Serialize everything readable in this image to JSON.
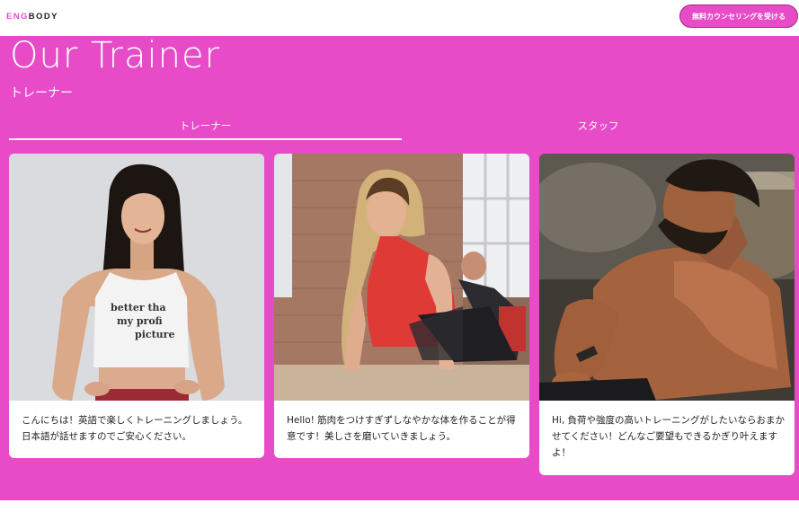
{
  "header": {
    "logo_accent": "ENG",
    "logo_rest": "BODY",
    "cta_label": "無料カウンセリングを受ける"
  },
  "section": {
    "title": "Our Trainer",
    "subtitle": "トレーナー",
    "tabs": [
      {
        "label": "トレーナー",
        "active": true
      },
      {
        "label": "スタッフ",
        "active": false
      }
    ]
  },
  "trainers": [
    {
      "text": "こんにちは！英語で楽しくトレーニングしましょう。日本語が話せますのでご安心ください。",
      "shirt_text": "better that is my profile picture"
    },
    {
      "text": "Hello! 筋肉をつけすぎずしなやかな体を作ることが得意です！美しさを磨いていきましょう。"
    },
    {
      "text": "Hi, 負荷や強度の高いトレーニングがしたいならおまかせてください！どんなご要望もできるかぎり叶えますよ！"
    }
  ],
  "colors": {
    "accent": "#e84bc8",
    "cta_border": "#9b2f86"
  }
}
